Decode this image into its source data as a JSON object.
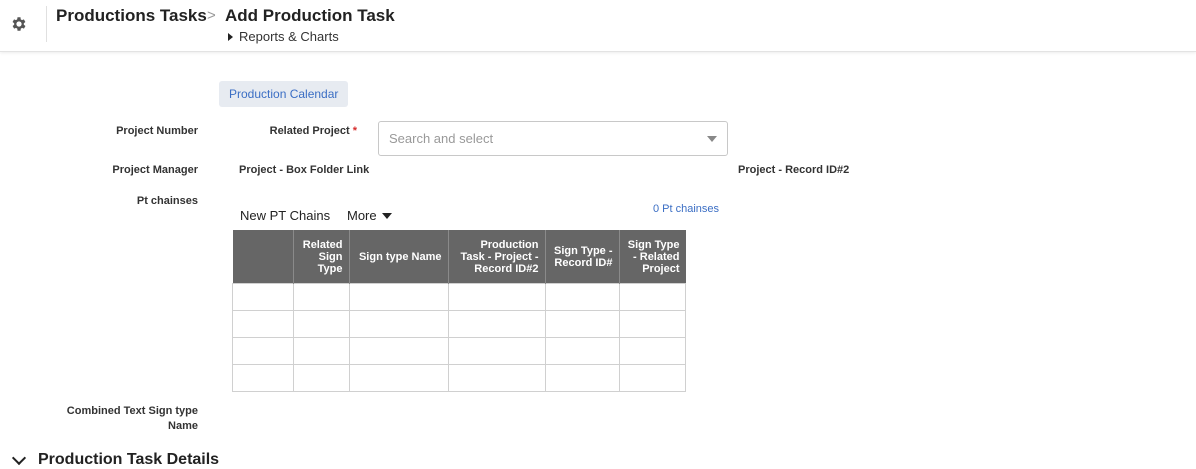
{
  "header": {
    "breadcrumb_table": "Productions Tasks",
    "breadcrumb_separator": ">",
    "page_title": "Add Production Task",
    "reports_link": "Reports & Charts"
  },
  "form": {
    "calendar_button": "Production Calendar",
    "project_number_label": "Project Number",
    "related_project_label": "Related Project",
    "required_marker": "*",
    "related_project_placeholder": "Search and select",
    "project_manager_label": "Project Manager",
    "box_folder_label": "Project - Box Folder Link",
    "record_id_label": "Project - Record ID#2",
    "pt_chainses_label": "Pt chainses",
    "combined_text_label_line1": "Combined Text Sign type",
    "combined_text_label_line2": "Name"
  },
  "embedded": {
    "new_button": "New PT Chains",
    "more_button": "More",
    "count_text": "0 Pt chainses",
    "columns": [
      "",
      "Related Sign Type",
      "Sign type Name",
      "Production Task - Project - Record ID#2",
      "Sign Type - Record ID#",
      "Sign Type - Related Project"
    ],
    "empty_rows": 4
  },
  "section": {
    "title": "Production Task Details"
  },
  "colors": {
    "accent": "#3b6ec4",
    "table_header": "#666666",
    "required": "#d62b2b"
  }
}
